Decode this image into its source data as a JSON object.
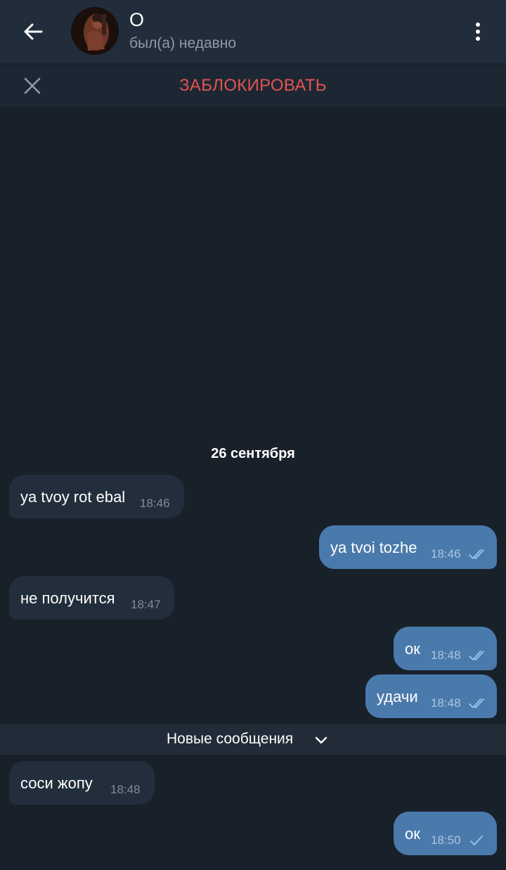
{
  "header": {
    "contact_name": "О",
    "status": "был(а) недавно"
  },
  "block_bar": {
    "label": "ЗАБЛОКИРОВАТЬ"
  },
  "chat": {
    "date_separator": "26 сентября",
    "messages": [
      {
        "direction": "in",
        "text": "ya tvoy rot ebal",
        "time": "18:46"
      },
      {
        "direction": "out",
        "text": "ya tvoi tozhe",
        "time": "18:46",
        "status": "read"
      },
      {
        "direction": "in",
        "text": "не получится",
        "time": "18:47"
      },
      {
        "direction": "out",
        "text": "ок",
        "time": "18:48",
        "status": "read"
      },
      {
        "direction": "out",
        "text": "удачи",
        "time": "18:48",
        "status": "read"
      },
      {
        "direction": "in",
        "text": "соси жопу",
        "time": "18:48"
      },
      {
        "direction": "out",
        "text": "ок",
        "time": "18:50",
        "status": "sent"
      }
    ],
    "new_messages_label": "Новые сообщения"
  },
  "colors": {
    "background": "#18202a",
    "header": "#212d3b",
    "incoming_bubble": "#222e3b",
    "outgoing_bubble": "#4a7aab",
    "block_text": "#e2534f",
    "status_text": "#8e9aa8"
  },
  "icons": {
    "back": "arrow-left-icon",
    "menu": "more-vertical-icon",
    "close": "close-icon",
    "read": "double-check-icon",
    "sent": "single-check-icon",
    "chevron": "chevron-down-icon"
  }
}
